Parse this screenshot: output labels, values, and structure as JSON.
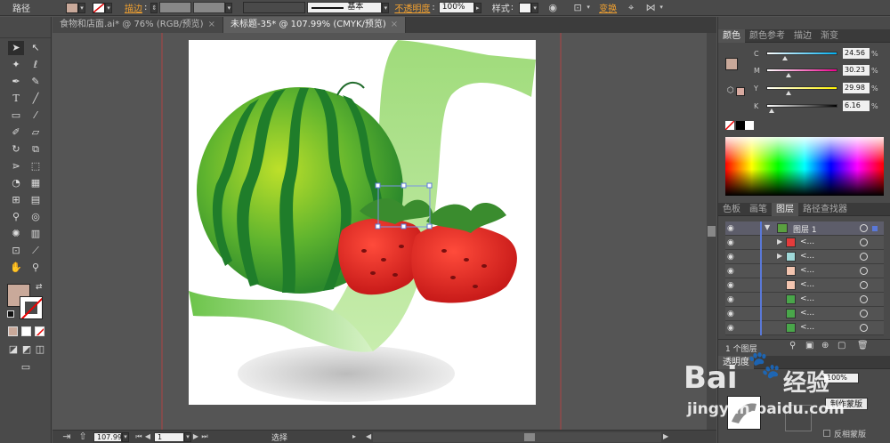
{
  "control_bar": {
    "object_type": "路径",
    "fill_color": "#c9a99a",
    "stroke_label": "描边",
    "stroke_weight_value": "",
    "stroke_profile_label": "基本",
    "opacity_label": "不透明度",
    "opacity_value": "100%",
    "style_label": "样式",
    "transform_label": "变换"
  },
  "doc_tabs": [
    {
      "label": "食物和店面.ai* @ 76% (RGB/预览)",
      "close": "×"
    },
    {
      "label": "未标题-35* @ 107.99% (CMYK/预览)",
      "close": "×"
    }
  ],
  "toolbar": {
    "fill_color": "#c9a99a",
    "tools": [
      "selection-tool-icon",
      "direct-selection-tool-icon",
      "magic-wand-tool-icon",
      "lasso-tool-icon",
      "pen-tool-icon",
      "curvature-tool-icon",
      "type-tool-icon",
      "line-segment-tool-icon",
      "rectangle-tool-icon",
      "paintbrush-tool-icon",
      "pencil-tool-icon",
      "eraser-tool-icon",
      "rotate-tool-icon",
      "scale-tool-icon",
      "width-tool-icon",
      "free-transform-tool-icon",
      "shape-builder-tool-icon",
      "perspective-grid-tool-icon",
      "mesh-tool-icon",
      "gradient-tool-icon",
      "eyedropper-tool-icon",
      "blend-tool-icon",
      "symbol-sprayer-tool-icon",
      "column-graph-tool-icon",
      "artboard-tool-icon",
      "slice-tool-icon",
      "hand-tool-icon",
      "zoom-tool-icon"
    ]
  },
  "status_bar": {
    "zoom_value": "107.99",
    "artboard_value": "1",
    "tool_label": "选择"
  },
  "color_panel": {
    "tabs": [
      "颜色",
      "颜色参考",
      "描边",
      "渐变"
    ],
    "sliders": [
      {
        "label": "C",
        "value": "24.56",
        "unit": "%",
        "level": 24.56
      },
      {
        "label": "M",
        "value": "30.23",
        "unit": "%",
        "level": 30.23
      },
      {
        "label": "Y",
        "value": "29.98",
        "unit": "%",
        "level": 29.98
      },
      {
        "label": "K",
        "value": "6.16",
        "unit": "%",
        "level": 6.16
      }
    ],
    "fill_color": "#c9a99a",
    "stroke_color": "#d8aaa0"
  },
  "layers_panel": {
    "tabs": [
      "色板",
      "画笔",
      "图层",
      "路径查找器"
    ],
    "top_layer_name": "图层 1",
    "sublayer_name": "<...",
    "layer_count_label": "1 个图层",
    "thumbs": [
      "#e43b3b",
      "#9fd8d8",
      "#f3c5b0",
      "#f3c5b0",
      "#49a64a",
      "#49a64a",
      "#49a64a"
    ]
  },
  "transparency_panel": {
    "tab_label": "透明度",
    "opacity_value": "100%",
    "make_mask_button": "制作蒙版",
    "invert_mask_label": "反相蒙版"
  },
  "watermark": {
    "brand": "Bai",
    "brand_cn": "经验",
    "url": "jingyan.baidu.com"
  }
}
